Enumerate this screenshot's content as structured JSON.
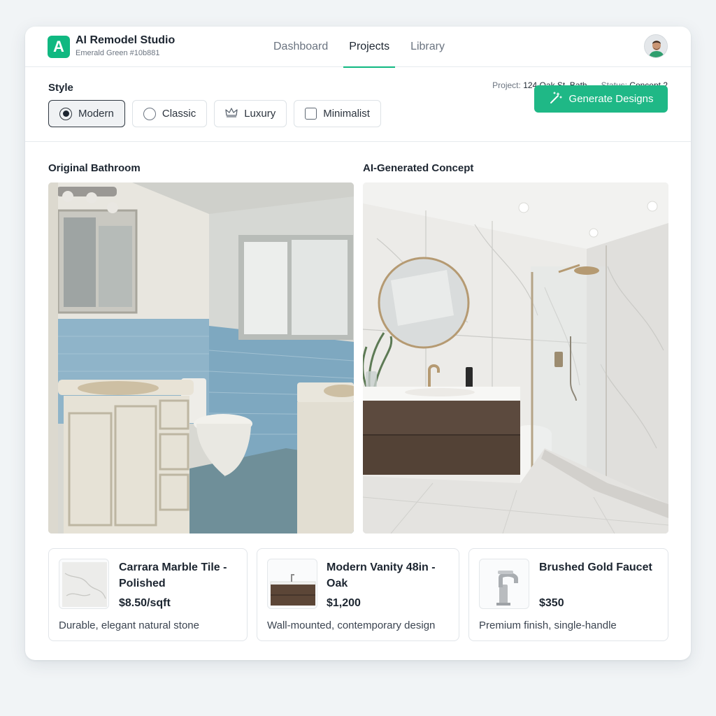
{
  "app": {
    "title": "AI Remodel Studio",
    "subtitle": "Emerald Green #10b881",
    "logo_letter": "A",
    "accent_color": "#10b881"
  },
  "nav": {
    "items": [
      {
        "label": "Dashboard",
        "active": false
      },
      {
        "label": "Projects",
        "active": true
      },
      {
        "label": "Library",
        "active": false
      }
    ]
  },
  "toolbar": {
    "style_label": "Style",
    "project_label": "Project:",
    "project_value": "124 Oak St. Bath",
    "status_label": "Status:",
    "status_value": "Concept 2",
    "options": [
      {
        "label": "Modern",
        "icon": "radio-selected-icon",
        "selected": true
      },
      {
        "label": "Classic",
        "icon": "radio-empty-icon",
        "selected": false
      },
      {
        "label": "Luxury",
        "icon": "crown-icon",
        "selected": false
      },
      {
        "label": "Minimalist",
        "icon": "checkbox-icon",
        "selected": false
      }
    ],
    "generate_label": "Generate Designs"
  },
  "panels": {
    "original_title": "Original Bathroom",
    "concept_title": "AI-Generated Concept"
  },
  "products": [
    {
      "name_line1": "Carrara Marble Tile -",
      "name_line2": "Polished",
      "price": "$8.50/sqft",
      "description": "Durable, elegant natural stone",
      "icon": "marble-tile-thumbnail"
    },
    {
      "name_line1": "Modern Vanity 48in -",
      "name_line2": "Oak",
      "price": "$1,200",
      "description": "Wall-mounted, contemporary design",
      "icon": "vanity-thumbnail"
    },
    {
      "name_line1": "Brushed Gold Faucet",
      "name_line2": "",
      "price": "$350",
      "description": "Premium finish, single-handle",
      "icon": "faucet-thumbnail"
    }
  ]
}
